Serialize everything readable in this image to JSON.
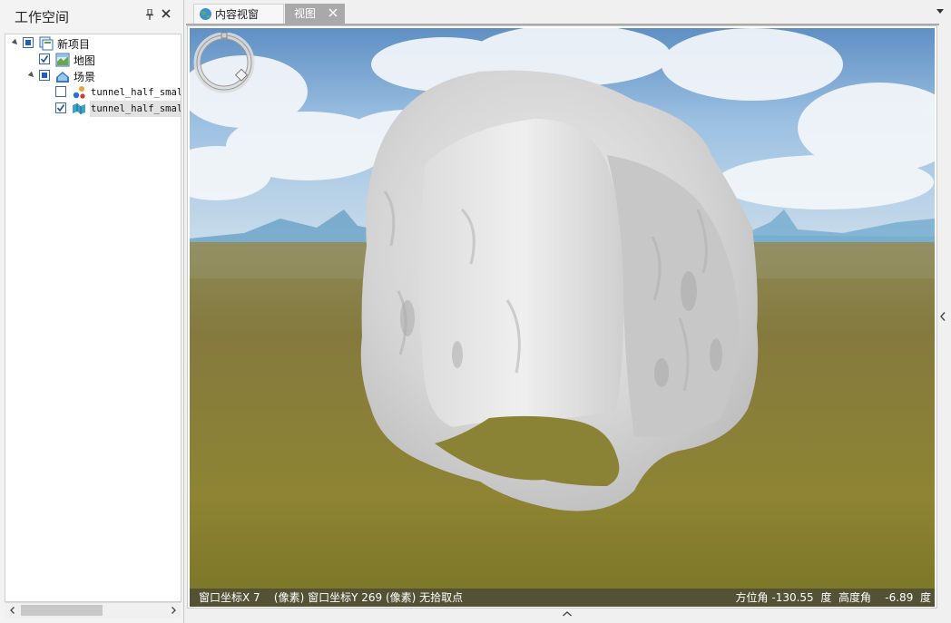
{
  "workspace": {
    "title": "工作空间",
    "tree": {
      "root": {
        "label": "新项目"
      },
      "map": {
        "label": "地图"
      },
      "scene": {
        "label": "场景"
      },
      "layer1": {
        "label": "tunnel_half_small"
      },
      "layer2": {
        "label": "tunnel_half_small"
      }
    }
  },
  "tabs": [
    {
      "label": "内容视窗"
    },
    {
      "label": "视图"
    }
  ],
  "status": {
    "left": "窗口坐标X 7    (像素) 窗口坐标Y 269 (像素) 无拾取点",
    "azimuth_label": "方位角",
    "azimuth_value": "-130.55",
    "azimuth_unit": "度",
    "elevation_label": "高度角",
    "elevation_value": "-6.89",
    "elevation_unit": "度"
  }
}
